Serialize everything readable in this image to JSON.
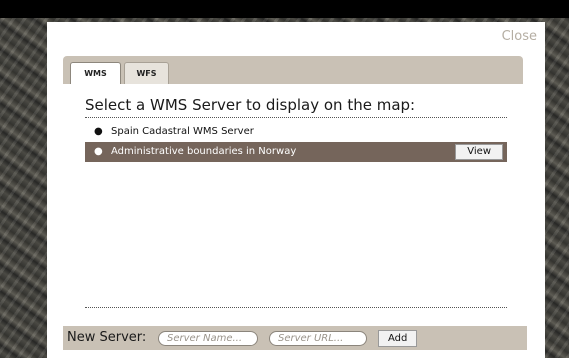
{
  "dialog": {
    "close_label": "Close"
  },
  "tabs": [
    {
      "label": "WMS",
      "active": true
    },
    {
      "label": "WFS",
      "active": false
    }
  ],
  "main": {
    "heading": "Select a WMS Server to display on the map:",
    "servers": [
      {
        "name": "Spain Cadastral WMS Server",
        "selected": false
      },
      {
        "name": "Administrative boundaries in Norway",
        "selected": true,
        "action_label": "View"
      }
    ]
  },
  "new_server": {
    "label": "New Server:",
    "name_placeholder": "Server Name...",
    "url_placeholder": "Server URL...",
    "add_label": "Add"
  },
  "colors": {
    "bar_bg": "#c9c1b5",
    "selected_row_bg": "#75655b",
    "close_text": "#b5aea3"
  }
}
